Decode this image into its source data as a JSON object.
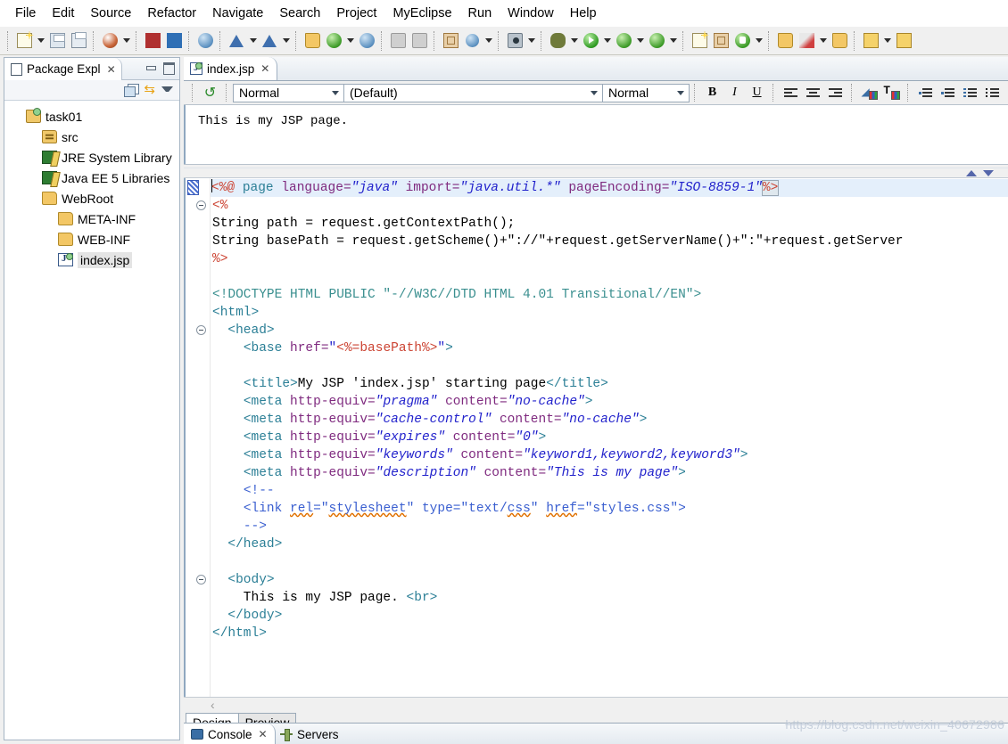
{
  "window": {
    "menu": [
      "File",
      "Edit",
      "Source",
      "Refactor",
      "Navigate",
      "Search",
      "Project",
      "MyEclipse",
      "Run",
      "Window",
      "Help"
    ]
  },
  "toolbar": {
    "groups": [
      {
        "items": [
          {
            "name": "new-wizard-icon",
            "icon": "new-document",
            "arrow": true
          },
          {
            "name": "save-icon",
            "icon": "save",
            "arrow": false
          },
          {
            "name": "print-icon",
            "icon": "print",
            "arrow": false
          }
        ]
      },
      {
        "items": [
          {
            "name": "new-deployment-icon",
            "icon": "deploy-ball",
            "arrow": true
          }
        ]
      },
      {
        "items": [
          {
            "name": "open-db-browser-icon",
            "icon": "cube-red",
            "arrow": false
          },
          {
            "name": "open-db-explorer-icon",
            "icon": "cube-blue",
            "arrow": false
          }
        ]
      },
      {
        "items": [
          {
            "name": "web-20-icon",
            "icon": "web20",
            "arrow": false
          }
        ]
      },
      {
        "items": [
          {
            "name": "run-configuration-icon",
            "icon": "triangle-blue",
            "arrow": true
          },
          {
            "name": "validate-icon",
            "icon": "triangle-blue-doc",
            "arrow": true
          }
        ]
      },
      {
        "items": [
          {
            "name": "deploy-myeclipse-icon",
            "icon": "folder-deploy",
            "arrow": false
          },
          {
            "name": "start-server-icon",
            "icon": "server-run",
            "arrow": true
          },
          {
            "name": "open-browser-icon",
            "icon": "globe",
            "arrow": false
          }
        ]
      },
      {
        "items": [
          {
            "name": "deploy-disabled-icon",
            "icon": "gray-1",
            "arrow": false
          },
          {
            "name": "reload-disabled-icon",
            "icon": "gray-2",
            "arrow": false
          }
        ]
      },
      {
        "items": [
          {
            "name": "new-report-icon",
            "icon": "report",
            "arrow": false
          },
          {
            "name": "preview-report-icon",
            "icon": "globe-small",
            "arrow": true
          }
        ]
      },
      {
        "items": [
          {
            "name": "snapshot-icon",
            "icon": "camera",
            "arrow": true
          }
        ]
      },
      {
        "items": [
          {
            "name": "debug-icon",
            "icon": "bug",
            "arrow": true
          },
          {
            "name": "run-icon",
            "icon": "run-green",
            "arrow": true
          },
          {
            "name": "run-history-icon",
            "icon": "run-clock",
            "arrow": true
          },
          {
            "name": "profile-icon",
            "icon": "run-case",
            "arrow": true
          }
        ]
      },
      {
        "items": [
          {
            "name": "new-java-class-icon",
            "icon": "class-new",
            "arrow": false
          },
          {
            "name": "new-package-icon",
            "icon": "package-new",
            "arrow": false
          },
          {
            "name": "open-type-icon",
            "icon": "open-type",
            "arrow": true
          }
        ]
      },
      {
        "items": [
          {
            "name": "open-resource-icon",
            "icon": "folder-open",
            "arrow": false
          },
          {
            "name": "search-icon",
            "icon": "pen",
            "arrow": true
          },
          {
            "name": "open-task-icon",
            "icon": "folder-task",
            "arrow": false
          }
        ]
      },
      {
        "items": [
          {
            "name": "previous-annotation-icon",
            "icon": "arrow-down",
            "arrow": true
          },
          {
            "name": "next-annotation-icon",
            "icon": "arrow-up",
            "arrow": false
          }
        ]
      }
    ]
  },
  "package_explorer": {
    "title": "Package Expl",
    "close_glyph": "✕",
    "toolbar": {
      "collapse_all": "collapse-all",
      "link_with_editor": "link-with-editor",
      "view_menu": "view-menu"
    },
    "tree": [
      {
        "label": "task01",
        "icon": "project",
        "indent": 0,
        "selected": false
      },
      {
        "label": "src",
        "icon": "source",
        "indent": 1,
        "selected": false
      },
      {
        "label": "JRE System Library",
        "icon": "library",
        "indent": 1,
        "selected": false
      },
      {
        "label": "Java EE 5 Libraries",
        "icon": "library",
        "indent": 1,
        "selected": false
      },
      {
        "label": "WebRoot",
        "icon": "folder",
        "indent": 1,
        "selected": false
      },
      {
        "label": "META-INF",
        "icon": "folder",
        "indent": 2,
        "selected": false
      },
      {
        "label": "WEB-INF",
        "icon": "folder",
        "indent": 2,
        "selected": false
      },
      {
        "label": "index.jsp",
        "icon": "jsp",
        "indent": 2,
        "selected": true
      }
    ]
  },
  "editor": {
    "tab": {
      "title": "index.jsp",
      "icon": "jsp-file-icon",
      "close_glyph": "✕"
    },
    "format_toolbar": {
      "refresh_icon": "refresh-icon",
      "style_combo": {
        "value": "Normal"
      },
      "font_combo": {
        "value": "(Default)"
      },
      "size_combo": {
        "value": "Normal"
      },
      "bold": "B",
      "italic": "I",
      "underline": "U",
      "align_left": "align-left",
      "align_center": "align-center",
      "align_right": "align-right",
      "background_color": "background-color",
      "font_color": "font-color",
      "indent": "indent",
      "outdent": "outdent",
      "ordered_list": "ordered-list",
      "unordered_list": "unordered-list"
    },
    "design_preview_text": "This is my JSP page.",
    "bottom_tabs": [
      {
        "label": "Design",
        "active": true
      },
      {
        "label": "Preview",
        "active": false
      }
    ],
    "hscroll_left_glyph": "‹",
    "source": {
      "lines": [
        {
          "current": true,
          "fold": false,
          "marker": true,
          "parts": [
            {
              "t": "jsp",
              "s": "<%@"
            },
            {
              "t": "txt",
              "s": " "
            },
            {
              "t": "tag",
              "s": "page"
            },
            {
              "t": "txt",
              "s": " "
            },
            {
              "t": "attr",
              "s": "language="
            },
            {
              "t": "val",
              "s": "\"java\""
            },
            {
              "t": "txt",
              "s": " "
            },
            {
              "t": "attr",
              "s": "import="
            },
            {
              "t": "val",
              "s": "\"java.util.*\""
            },
            {
              "t": "txt",
              "s": " "
            },
            {
              "t": "attr",
              "s": "pageEncoding="
            },
            {
              "t": "val",
              "s": "\"ISO-8859-1\""
            },
            {
              "t": "jspb",
              "s": "%>"
            }
          ]
        },
        {
          "current": false,
          "fold": true,
          "marker": false,
          "parts": [
            {
              "t": "jsp",
              "s": "<%"
            }
          ]
        },
        {
          "current": false,
          "fold": false,
          "marker": false,
          "parts": [
            {
              "t": "java",
              "s": "String path = request.getContextPath();"
            }
          ]
        },
        {
          "current": false,
          "fold": false,
          "marker": false,
          "parts": [
            {
              "t": "java",
              "s": "String basePath = request.getScheme()+\"://\"+request.getServerName()+\":\"+request.getServer"
            }
          ]
        },
        {
          "current": false,
          "fold": false,
          "marker": false,
          "parts": [
            {
              "t": "jsp",
              "s": "%>"
            }
          ]
        },
        {
          "current": false,
          "fold": false,
          "marker": false,
          "parts": []
        },
        {
          "current": false,
          "fold": false,
          "marker": false,
          "parts": [
            {
              "t": "doct",
              "s": "<!DOCTYPE HTML PUBLIC \"-//W3C//DTD HTML 4.01 Transitional//EN\">"
            }
          ]
        },
        {
          "current": false,
          "fold": false,
          "marker": false,
          "parts": [
            {
              "t": "tag",
              "s": "<html>"
            }
          ]
        },
        {
          "current": false,
          "fold": true,
          "marker": false,
          "parts": [
            {
              "t": "txt",
              "s": "  "
            },
            {
              "t": "tag",
              "s": "<head>"
            }
          ]
        },
        {
          "current": false,
          "fold": false,
          "marker": false,
          "parts": [
            {
              "t": "txt",
              "s": "    "
            },
            {
              "t": "tag",
              "s": "<base"
            },
            {
              "t": "txt",
              "s": " "
            },
            {
              "t": "attr",
              "s": "href="
            },
            {
              "t": "valn",
              "s": "\""
            },
            {
              "t": "jsp",
              "s": "<%=basePath%>"
            },
            {
              "t": "valn",
              "s": "\""
            },
            {
              "t": "tag",
              "s": ">"
            }
          ]
        },
        {
          "current": false,
          "fold": false,
          "marker": false,
          "parts": []
        },
        {
          "current": false,
          "fold": false,
          "marker": false,
          "parts": [
            {
              "t": "txt",
              "s": "    "
            },
            {
              "t": "tag",
              "s": "<title>"
            },
            {
              "t": "txt",
              "s": "My JSP 'index.jsp' starting page"
            },
            {
              "t": "tag",
              "s": "</title>"
            }
          ]
        },
        {
          "current": false,
          "fold": false,
          "marker": false,
          "parts": [
            {
              "t": "txt",
              "s": "    "
            },
            {
              "t": "tag",
              "s": "<meta"
            },
            {
              "t": "txt",
              "s": " "
            },
            {
              "t": "attr",
              "s": "http-equiv="
            },
            {
              "t": "val",
              "s": "\"pragma\""
            },
            {
              "t": "txt",
              "s": " "
            },
            {
              "t": "attr",
              "s": "content="
            },
            {
              "t": "val",
              "s": "\"no-cache\""
            },
            {
              "t": "tag",
              "s": ">"
            }
          ]
        },
        {
          "current": false,
          "fold": false,
          "marker": false,
          "parts": [
            {
              "t": "txt",
              "s": "    "
            },
            {
              "t": "tag",
              "s": "<meta"
            },
            {
              "t": "txt",
              "s": " "
            },
            {
              "t": "attr",
              "s": "http-equiv="
            },
            {
              "t": "val",
              "s": "\"cache-control\""
            },
            {
              "t": "txt",
              "s": " "
            },
            {
              "t": "attr",
              "s": "content="
            },
            {
              "t": "val",
              "s": "\"no-cache\""
            },
            {
              "t": "tag",
              "s": ">"
            }
          ]
        },
        {
          "current": false,
          "fold": false,
          "marker": false,
          "parts": [
            {
              "t": "txt",
              "s": "    "
            },
            {
              "t": "tag",
              "s": "<meta"
            },
            {
              "t": "txt",
              "s": " "
            },
            {
              "t": "attr",
              "s": "http-equiv="
            },
            {
              "t": "val",
              "s": "\"expires\""
            },
            {
              "t": "txt",
              "s": " "
            },
            {
              "t": "attr",
              "s": "content="
            },
            {
              "t": "val",
              "s": "\"0\""
            },
            {
              "t": "tag",
              "s": ">"
            }
          ]
        },
        {
          "current": false,
          "fold": false,
          "marker": false,
          "parts": [
            {
              "t": "txt",
              "s": "    "
            },
            {
              "t": "tag",
              "s": "<meta"
            },
            {
              "t": "txt",
              "s": " "
            },
            {
              "t": "attr",
              "s": "http-equiv="
            },
            {
              "t": "val",
              "s": "\"keywords\""
            },
            {
              "t": "txt",
              "s": " "
            },
            {
              "t": "attr",
              "s": "content="
            },
            {
              "t": "val",
              "s": "\"keyword1,keyword2,keyword3\""
            },
            {
              "t": "tag",
              "s": ">"
            }
          ]
        },
        {
          "current": false,
          "fold": false,
          "marker": false,
          "parts": [
            {
              "t": "txt",
              "s": "    "
            },
            {
              "t": "tag",
              "s": "<meta"
            },
            {
              "t": "txt",
              "s": " "
            },
            {
              "t": "attr",
              "s": "http-equiv="
            },
            {
              "t": "val",
              "s": "\"description\""
            },
            {
              "t": "txt",
              "s": " "
            },
            {
              "t": "attr",
              "s": "content="
            },
            {
              "t": "val",
              "s": "\"This is my page\""
            },
            {
              "t": "tag",
              "s": ">"
            }
          ]
        },
        {
          "current": false,
          "fold": false,
          "marker": false,
          "parts": [
            {
              "t": "txt",
              "s": "    "
            },
            {
              "t": "cmt",
              "s": "<!--"
            }
          ]
        },
        {
          "current": false,
          "fold": false,
          "marker": false,
          "parts": [
            {
              "t": "txt",
              "s": "    "
            },
            {
              "t": "cmt",
              "s": "<link "
            },
            {
              "t": "cmtsq",
              "s": "rel"
            },
            {
              "t": "cmt",
              "s": "=\""
            },
            {
              "t": "cmtsq",
              "s": "stylesheet"
            },
            {
              "t": "cmt",
              "s": "\" type=\"text/"
            },
            {
              "t": "cmtsq",
              "s": "css"
            },
            {
              "t": "cmt",
              "s": "\" "
            },
            {
              "t": "cmtsq",
              "s": "href"
            },
            {
              "t": "cmt",
              "s": "=\"styles.css\">"
            }
          ]
        },
        {
          "current": false,
          "fold": false,
          "marker": false,
          "parts": [
            {
              "t": "txt",
              "s": "    "
            },
            {
              "t": "cmt",
              "s": "-->"
            }
          ]
        },
        {
          "current": false,
          "fold": false,
          "marker": false,
          "parts": [
            {
              "t": "txt",
              "s": "  "
            },
            {
              "t": "tag",
              "s": "</head>"
            }
          ]
        },
        {
          "current": false,
          "fold": false,
          "marker": false,
          "parts": []
        },
        {
          "current": false,
          "fold": true,
          "marker": false,
          "parts": [
            {
              "t": "txt",
              "s": "  "
            },
            {
              "t": "tag",
              "s": "<body>"
            }
          ]
        },
        {
          "current": false,
          "fold": false,
          "marker": false,
          "parts": [
            {
              "t": "txt",
              "s": "    This is my JSP page. "
            },
            {
              "t": "tag",
              "s": "<br>"
            }
          ]
        },
        {
          "current": false,
          "fold": false,
          "marker": false,
          "parts": [
            {
              "t": "txt",
              "s": "  "
            },
            {
              "t": "tag",
              "s": "</body>"
            }
          ]
        },
        {
          "current": false,
          "fold": false,
          "marker": false,
          "parts": [
            {
              "t": "tag",
              "s": "</html>"
            }
          ]
        }
      ]
    }
  },
  "console_view": {
    "tabs": [
      {
        "label": "Console",
        "icon": "console-icon",
        "active": true,
        "close_glyph": "✕"
      },
      {
        "label": "Servers",
        "icon": "servers-icon",
        "active": false,
        "close_glyph": ""
      }
    ]
  },
  "watermark": {
    "text": "https://blog.csdn.net/weixin_40672986"
  },
  "colors": {
    "tag": "#2b7f96",
    "attribute": "#7f2a7f",
    "value": "#2222cc",
    "comment": "#3a5fd0",
    "jsp_scriptlet": "#cc4433",
    "doctype": "#3a8f8f",
    "current_line": "#e4effb",
    "selection": "#e4e4e4"
  }
}
